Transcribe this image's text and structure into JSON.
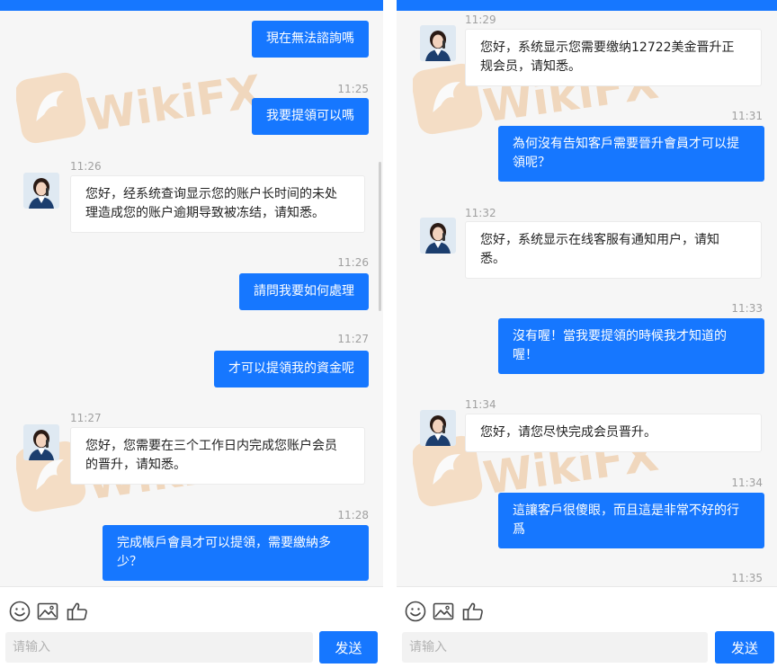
{
  "watermark": {
    "text": "WikiFX"
  },
  "colors": {
    "accent": "#1677ff",
    "background": "#f6f6f6",
    "watermark": "#e9b37a"
  },
  "left_panel": {
    "messages": [
      {
        "text": "現在無法諮詢嗎"
      },
      {
        "time": "11:25"
      },
      {
        "text": "我要提領可以嗎"
      },
      {
        "time": "11:26",
        "line1": "您好，经系统查询显示您的账户长时间的未处",
        "line2": "理造成您的账户逾期导致被冻结，请知悉。"
      },
      {
        "time": "11:26"
      },
      {
        "text": "請問我要如何處理"
      },
      {
        "time": "11:27"
      },
      {
        "text": "才可以提領我的資金呢"
      },
      {
        "time": "11:27",
        "line1": "您好，您需要在三个工作日内完成您账户会员",
        "line2": "的晋升，请知悉。"
      },
      {
        "time": "11:28"
      },
      {
        "line1": "完成帳戶會員才可以提領，需要繳納多",
        "line2": "少？"
      }
    ],
    "input_placeholder": "请输入",
    "send_label": "发送"
  },
  "right_panel": {
    "messages": [
      {
        "time": "11:29",
        "line1": "您好，系统显示您需要缴纳12722美金晋升正",
        "line2": "规会员，请知悉。"
      },
      {
        "time": "11:31"
      },
      {
        "line1": "為何沒有告知客戶需要晉升會員才可以提",
        "line2": "領呢？"
      },
      {
        "time": "11:32",
        "line1": "您好，系统显示在线客服有通知用户，请知",
        "line2": "悉。"
      },
      {
        "time": "11:33"
      },
      {
        "line1": "沒有喔！當我要提領的時候我才知道的",
        "line2": "喔！"
      },
      {
        "time": "11:34",
        "text": "您好，请您尽快完成会员晋升。"
      },
      {
        "time": "11:34"
      },
      {
        "line1": "這讓客戶很傻眼，而且這是非常不好的行",
        "line2": "爲"
      },
      {
        "time": "11:35"
      }
    ],
    "input_placeholder": "请输入",
    "send_label": "发送"
  },
  "icons": [
    "emoji-icon",
    "image-icon",
    "thumbs-up-icon"
  ]
}
